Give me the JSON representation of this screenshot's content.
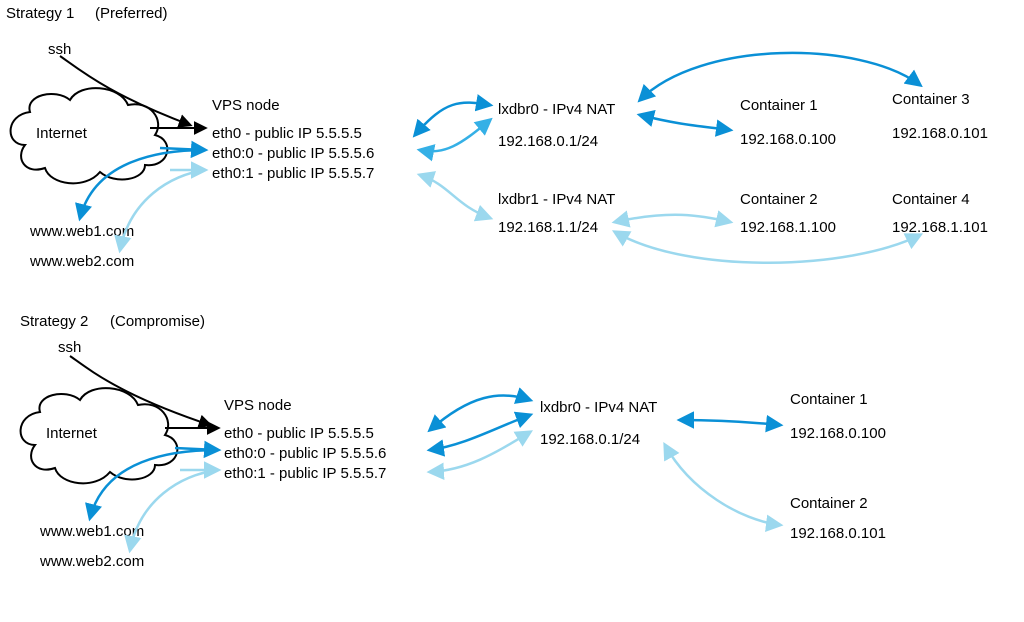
{
  "strategy1": {
    "title_a": "Strategy 1",
    "title_b": "(Preferred)",
    "ssh": "ssh",
    "internet": "Internet",
    "vps_node": "VPS node",
    "eth0": "eth0 - public IP 5.5.5.5",
    "eth00": "eth0:0 - public IP 5.5.5.6",
    "eth01": "eth0:1 - public IP 5.5.5.7",
    "web1": "www.web1.com",
    "web2": "www.web2.com",
    "br0_title": "lxdbr0 - IPv4 NAT",
    "br0_cidr": "192.168.0.1/24",
    "br1_title": "lxdbr1 - IPv4 NAT",
    "br1_cidr": "192.168.1.1/24",
    "c1_title": "Container 1",
    "c1_ip": "192.168.0.100",
    "c2_title": "Container 2",
    "c2_ip": "192.168.1.100",
    "c3_title": "Container 3",
    "c3_ip": "192.168.0.101",
    "c4_title": "Container 4",
    "c4_ip": "192.168.1.101"
  },
  "strategy2": {
    "title_a": "Strategy 2",
    "title_b": "(Compromise)",
    "ssh": "ssh",
    "internet": "Internet",
    "vps_node": "VPS node",
    "eth0": "eth0 - public IP 5.5.5.5",
    "eth00": "eth0:0 - public IP 5.5.5.6",
    "eth01": "eth0:1 - public IP 5.5.5.7",
    "web1": "www.web1.com",
    "web2": "www.web2.com",
    "br0_title": "lxdbr0 - IPv4 NAT",
    "br0_cidr": "192.168.0.1/24",
    "c1_title": "Container 1",
    "c1_ip": "192.168.0.100",
    "c2_title": "Container 2",
    "c2_ip": "192.168.0.101"
  },
  "colors": {
    "black": "#000000",
    "blue_dark": "#0a90d6",
    "blue_med": "#35b0e6",
    "blue_light": "#9bd8ee"
  }
}
